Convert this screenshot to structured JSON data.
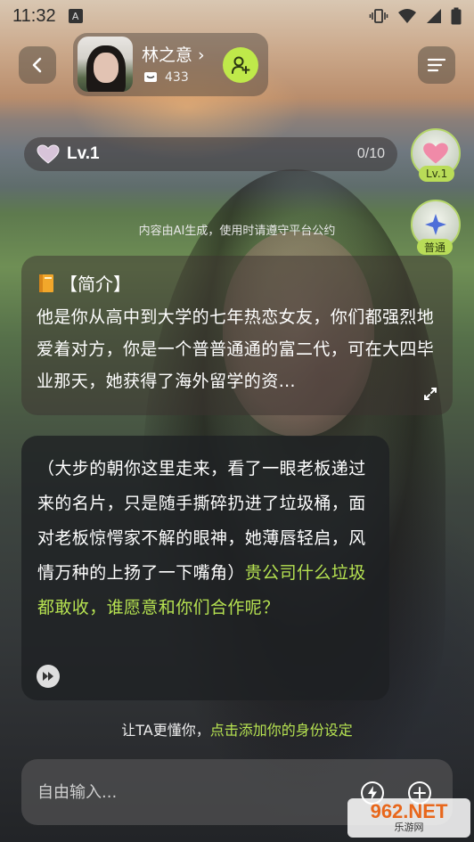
{
  "status_bar": {
    "time": "11:32",
    "notification_glyph": "A"
  },
  "profile": {
    "name": "林之意 ›",
    "fans": "433"
  },
  "level": {
    "label": "Lv.1",
    "progress": "0/10"
  },
  "side_badges": {
    "level_badge": "Lv.1",
    "mode_badge": "普通"
  },
  "ai_notice": "内容由AI生成，使用时请遵守平台公约",
  "intro": {
    "title": "【简介】",
    "text": "他是你从高中到大学的七年热恋女友，你们都强烈地爱着对方，你是一个普普通通的富二代，可在大四毕业那天，她获得了海外留学的资…"
  },
  "message": {
    "action": "（大步的朝你这里走来，看了一眼老板递过来的名片，只是随手撕碎扔进了垃圾桶，面对老板惊愕家不解的眼神，她薄唇轻启，风情万种的上扬了一下嘴角）",
    "speech": "贵公司什么垃圾都敢收，谁愿意和你们合作呢？"
  },
  "identity_hint": {
    "prefix": "让TA更懂你，",
    "link": "点击添加你的身份设定"
  },
  "input": {
    "placeholder": "自由输入..."
  },
  "watermark": {
    "main": "962.NET",
    "sub": "乐游网"
  },
  "colors": {
    "accent": "#bfe94a",
    "speech": "#b6e251"
  }
}
